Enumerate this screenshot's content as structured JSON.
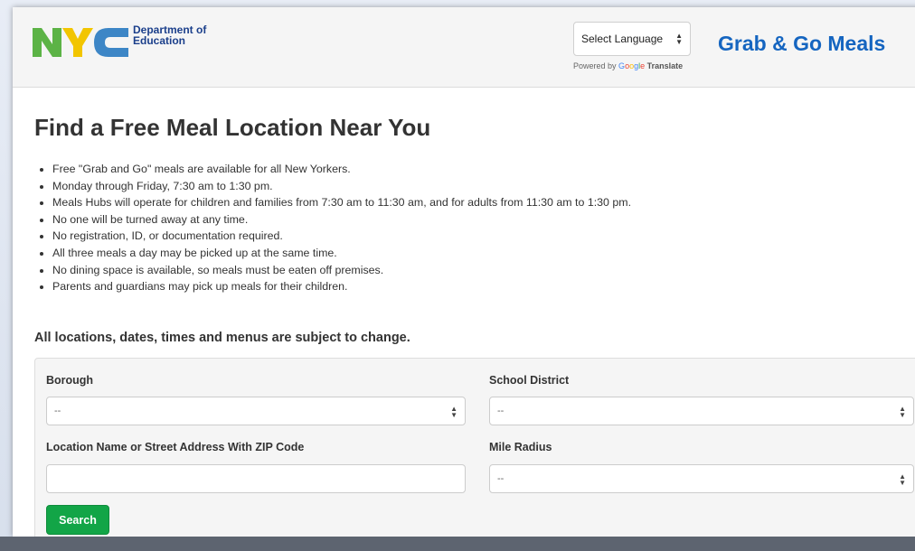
{
  "header": {
    "logo_text_line1": "Department of",
    "logo_text_line2": "Education",
    "language_select": "Select Language",
    "powered_by": "Powered by",
    "google_letters": [
      "G",
      "o",
      "o",
      "g",
      "l",
      "e"
    ],
    "translate": "Translate",
    "title": "Grab & Go Meals"
  },
  "main": {
    "title": "Find a Free Meal Location Near You",
    "bullets": [
      "Free \"Grab and Go\" meals are available for all New Yorkers.",
      "Monday through Friday, 7:30 am to 1:30 pm.",
      "Meals Hubs will operate for children and families from 7:30 am to 11:30 am, and for adults from 11:30 am to 1:30 pm.",
      "No one will be turned away at any time.",
      "No registration, ID, or documentation required.",
      "All three meals a day may be picked up at the same time.",
      "No dining space is available, so meals must be eaten off premises.",
      "Parents and guardians may pick up meals for their children."
    ],
    "notice": "All locations, dates, times and menus are subject to change."
  },
  "form": {
    "borough_label": "Borough",
    "borough_value": "--",
    "district_label": "School District",
    "district_value": "--",
    "location_label": "Location Name or Street Address With ZIP Code",
    "location_value": "",
    "radius_label": "Mile Radius",
    "radius_value": "--",
    "search_label": "Search"
  },
  "colors": {
    "accent_blue": "#1565c0",
    "search_green": "#12a547",
    "logo_green": "#5cb346",
    "logo_yellow": "#f2c500",
    "logo_blue": "#3d86c6"
  }
}
